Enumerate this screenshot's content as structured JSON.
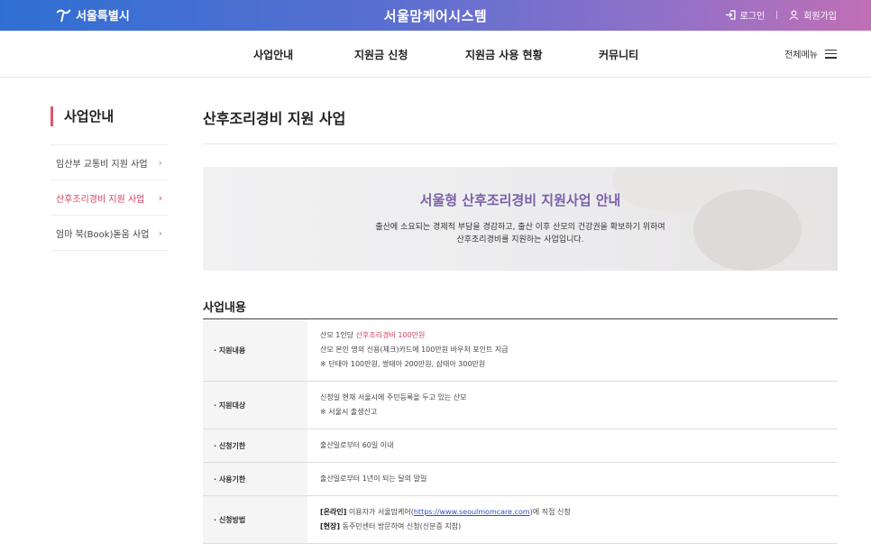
{
  "header": {
    "logo_text": "서울특별시",
    "site_title": "서울맘케어시스템",
    "login": "로그인",
    "signup": "회원가입"
  },
  "gnb": {
    "items": [
      "사업안내",
      "지원금 신청",
      "지원금 사용 현황",
      "커뮤니티"
    ],
    "all_menu": "전체메뉴"
  },
  "lnb": {
    "title": "사업안내",
    "items": [
      "임산부 교통비 지원 사업",
      "산후조리경비 지원 사업",
      "엄마 북(Book)돋움 사업"
    ],
    "active_index": 1
  },
  "content": {
    "title": "산후조리경비 지원 사업",
    "banner": {
      "title": "서울형 산후조리경비 지원사업 안내",
      "line1": "출산에 소요되는 경제적 부담을 경감하고, 출산 이후 산모의 건강권을 확보하기 위하여",
      "line2": "산후조리경비를 지원하는 사업입니다."
    },
    "section_title": "사업내용",
    "rows": {
      "support": {
        "label": "· 지원내용",
        "l1_prefix": "산모 1인당 ",
        "l1_highlight": "산후조리경비 100만원",
        "l2": "산모 본인 명의 신용(체크)카드에 100만원 바우처 포인트 지급",
        "l3": "※ 단태아 100만원, 쌍태아 200만원, 삼태아 300만원"
      },
      "target": {
        "label": "· 지원대상",
        "l1": "신청일 현재 서울시에 주민등록을 두고 있는 산모",
        "l2": "※ 서울시 출생신고"
      },
      "period": {
        "label": "· 신청기한",
        "l1": "출산일로부터 60일 이내"
      },
      "usage": {
        "label": "· 사용기한",
        "l1": "출산일로부터 1년이 되는 달의 말일"
      },
      "method": {
        "label": "· 신청방법",
        "online_tag": "[온라인]",
        "online_text": " 이용자가 서울맘케어(",
        "online_link": "https://www.seoulmomcare.com",
        "online_suffix": ")에 직접 신청",
        "onsite_tag": "[현장]",
        "onsite_text": " 동주민센터 방문하여 신청(신분증 지참)"
      }
    }
  },
  "colors": {
    "accent": "#d2405f",
    "banner_title": "#7b5fa8",
    "link": "#2b50c8"
  }
}
